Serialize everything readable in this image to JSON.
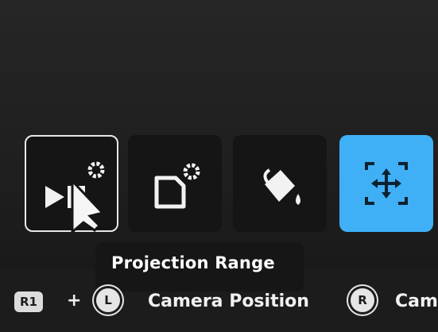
{
  "toolbar": {
    "tools": [
      {
        "name": "projection-tool",
        "icon": "play-cursor-gear-icon",
        "selected": true
      },
      {
        "name": "page-settings-tool",
        "icon": "page-gear-icon"
      },
      {
        "name": "fill-tool",
        "icon": "paint-bucket-icon"
      },
      {
        "name": "transform-tool",
        "icon": "move-arrows-icon",
        "active": true
      }
    ]
  },
  "tooltip": {
    "text": "Projection Range"
  },
  "hints": {
    "combo_key": "R1",
    "plus": "+",
    "left_stick": "L",
    "left_action": "Camera Position",
    "right_stick": "R",
    "right_action": "Cam"
  },
  "colors": {
    "accent": "#3fb0f5",
    "tile": "#151515",
    "background": "#1b1b1b"
  }
}
